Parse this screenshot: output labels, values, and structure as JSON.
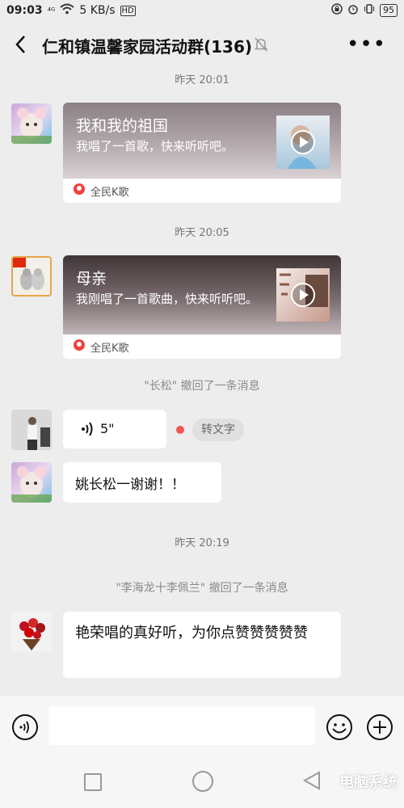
{
  "status": {
    "time": "09:03",
    "signal": "⁴ᴳ",
    "speed": "5 KB/s",
    "hd": "HD",
    "battery": "95"
  },
  "header": {
    "title": "仁和镇温馨家园活动群(136)",
    "more": "•••"
  },
  "messages": {
    "t1": "昨天 20:01",
    "card1": {
      "title": "我和我的祖国",
      "desc": "我唱了一首歌，快来听听吧。",
      "source": "全民K歌"
    },
    "t2": "昨天 20:05",
    "card2": {
      "title": "母亲",
      "desc": "我刚唱了一首歌曲，快来听听吧。",
      "source": "全民K歌"
    },
    "recall1": "\"长松\" 撤回了一条消息",
    "voice": {
      "duration": "5\"",
      "to_text": "转文字"
    },
    "text1": "姚长松一谢谢！！",
    "t3": "昨天 20:19",
    "recall2": "\"李海龙十李佩兰\" 撤回了一条消息",
    "text2": "艳荣唱的真好听，为你点赞赞赞赞赞"
  },
  "watermark": "电脑系统",
  "colors": {
    "background": "#ededed",
    "card": "#ffffff",
    "unread_dot": "#f25555"
  }
}
